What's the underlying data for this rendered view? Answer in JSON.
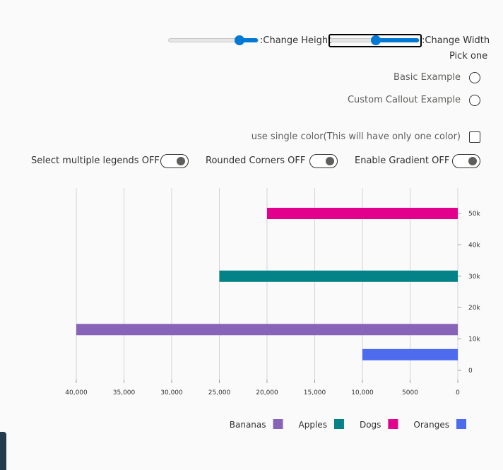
{
  "controls": {
    "height_label": ":Change Height",
    "width_label": ":Change Width",
    "height_value": 0.78,
    "width_value": 0.5,
    "pick_one": "Pick one",
    "radio_basic": "Basic Example",
    "radio_custom": "Custom Callout Example",
    "single_color_label": "use single color(This will have only one color)",
    "toggle_legends": "Select multiple legends OFF",
    "toggle_rounded": "Rounded Corners OFF",
    "toggle_gradient": "Enable Gradient OFF"
  },
  "colors": {
    "accent": "#0078d4",
    "grid": "#d4d4d4"
  },
  "chart_data": {
    "type": "bar",
    "orientation": "horizontal",
    "x_ticks": [
      "40,000",
      "35,000",
      "30,000",
      "25,000",
      "20,000",
      "15,000",
      "10,000",
      "5000",
      "0"
    ],
    "y_ticks": [
      "50k",
      "40k",
      "30k",
      "20k",
      "10k",
      "0"
    ],
    "xlim": [
      40000,
      0
    ],
    "ylim": [
      0,
      50000
    ],
    "y_axis_position": "right",
    "x_reversed": true,
    "grid": "vertical",
    "legend_position": "bottom-right",
    "series": [
      {
        "name": "Bananas",
        "x": 40000,
        "y": 13000,
        "color": "#8764b8"
      },
      {
        "name": "Apples",
        "x": 25000,
        "y": 30000,
        "color": "#038387"
      },
      {
        "name": "Dogs",
        "x": 20000,
        "y": 50000,
        "color": "#e3008c"
      },
      {
        "name": "Oranges",
        "x": 10000,
        "y": 5000,
        "color": "#4f6bed"
      }
    ]
  }
}
